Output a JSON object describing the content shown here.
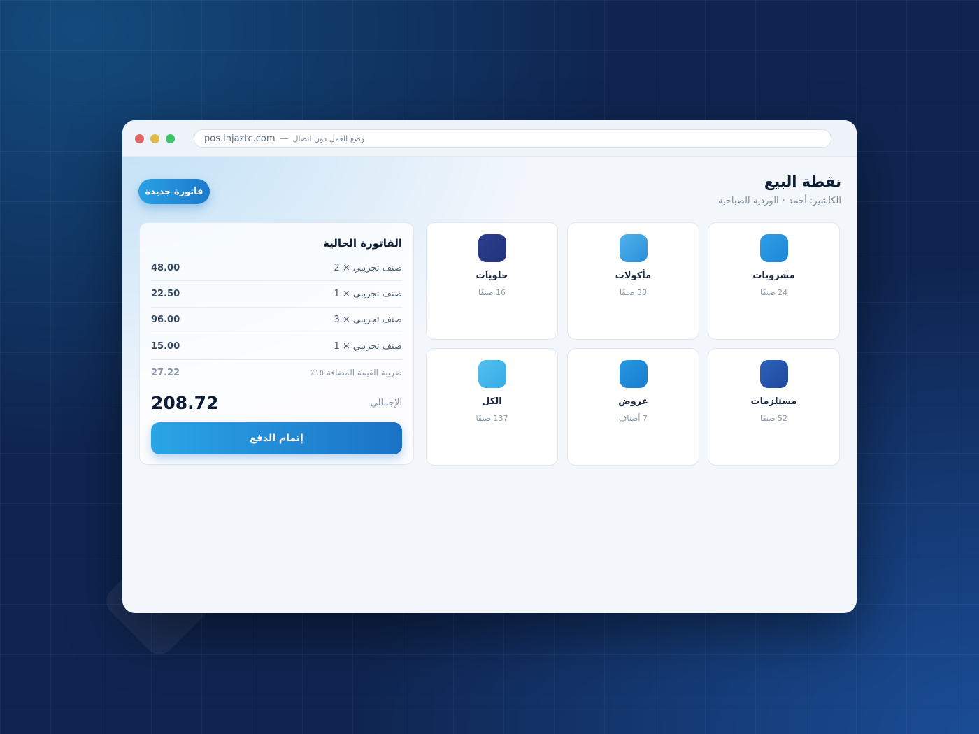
{
  "browser": {
    "domain": "pos.injaztc.com",
    "separator": "—",
    "mode": "وضع العمل دون اتصال"
  },
  "header": {
    "title": "نقطة البيع",
    "cashier": "الكاشير: أحمد",
    "bullet": "·",
    "shift": "الوردية الصباحية",
    "new_invoice": "فاتورة جديدة"
  },
  "invoice": {
    "title": "الفاتورة الحالية",
    "items": [
      {
        "label": "صنف تجريبي × 2",
        "amount": "48.00"
      },
      {
        "label": "صنف تجريبي × 1",
        "amount": "22.50"
      },
      {
        "label": "صنف تجريبي × 3",
        "amount": "96.00"
      },
      {
        "label": "صنف تجريبي × 1",
        "amount": "15.00"
      }
    ],
    "tax": {
      "label": "ضريبة القيمة المضافة ١٥٪",
      "amount": "27.22"
    },
    "total_label": "الإجمالي",
    "total_value": "208.72",
    "pay": "إتمام الدفع"
  },
  "categories": [
    {
      "name": "مشروبات",
      "count": "24 صنفًا",
      "icon": "beverages-icon",
      "color_from": "#2f9ee6",
      "color_to": "#1d86d6"
    },
    {
      "name": "مأكولات",
      "count": "38 صنفًا",
      "icon": "food-icon",
      "color_from": "#4fb2ea",
      "color_to": "#2a8fd9"
    },
    {
      "name": "حلويات",
      "count": "16 صنفًا",
      "icon": "desserts-icon",
      "color_from": "#2b3f8f",
      "color_to": "#23327a"
    },
    {
      "name": "مستلزمات",
      "count": "52 صنفًا",
      "icon": "supplies-icon",
      "color_from": "#2a63bc",
      "color_to": "#22479a"
    },
    {
      "name": "عروض",
      "count": "7 أصناف",
      "icon": "offers-icon",
      "color_from": "#2598e2",
      "color_to": "#1a7ccd"
    },
    {
      "name": "الكل",
      "count": "137 صنفًا",
      "icon": "all-icon",
      "color_from": "#52c1ef",
      "color_to": "#38abe6"
    }
  ]
}
